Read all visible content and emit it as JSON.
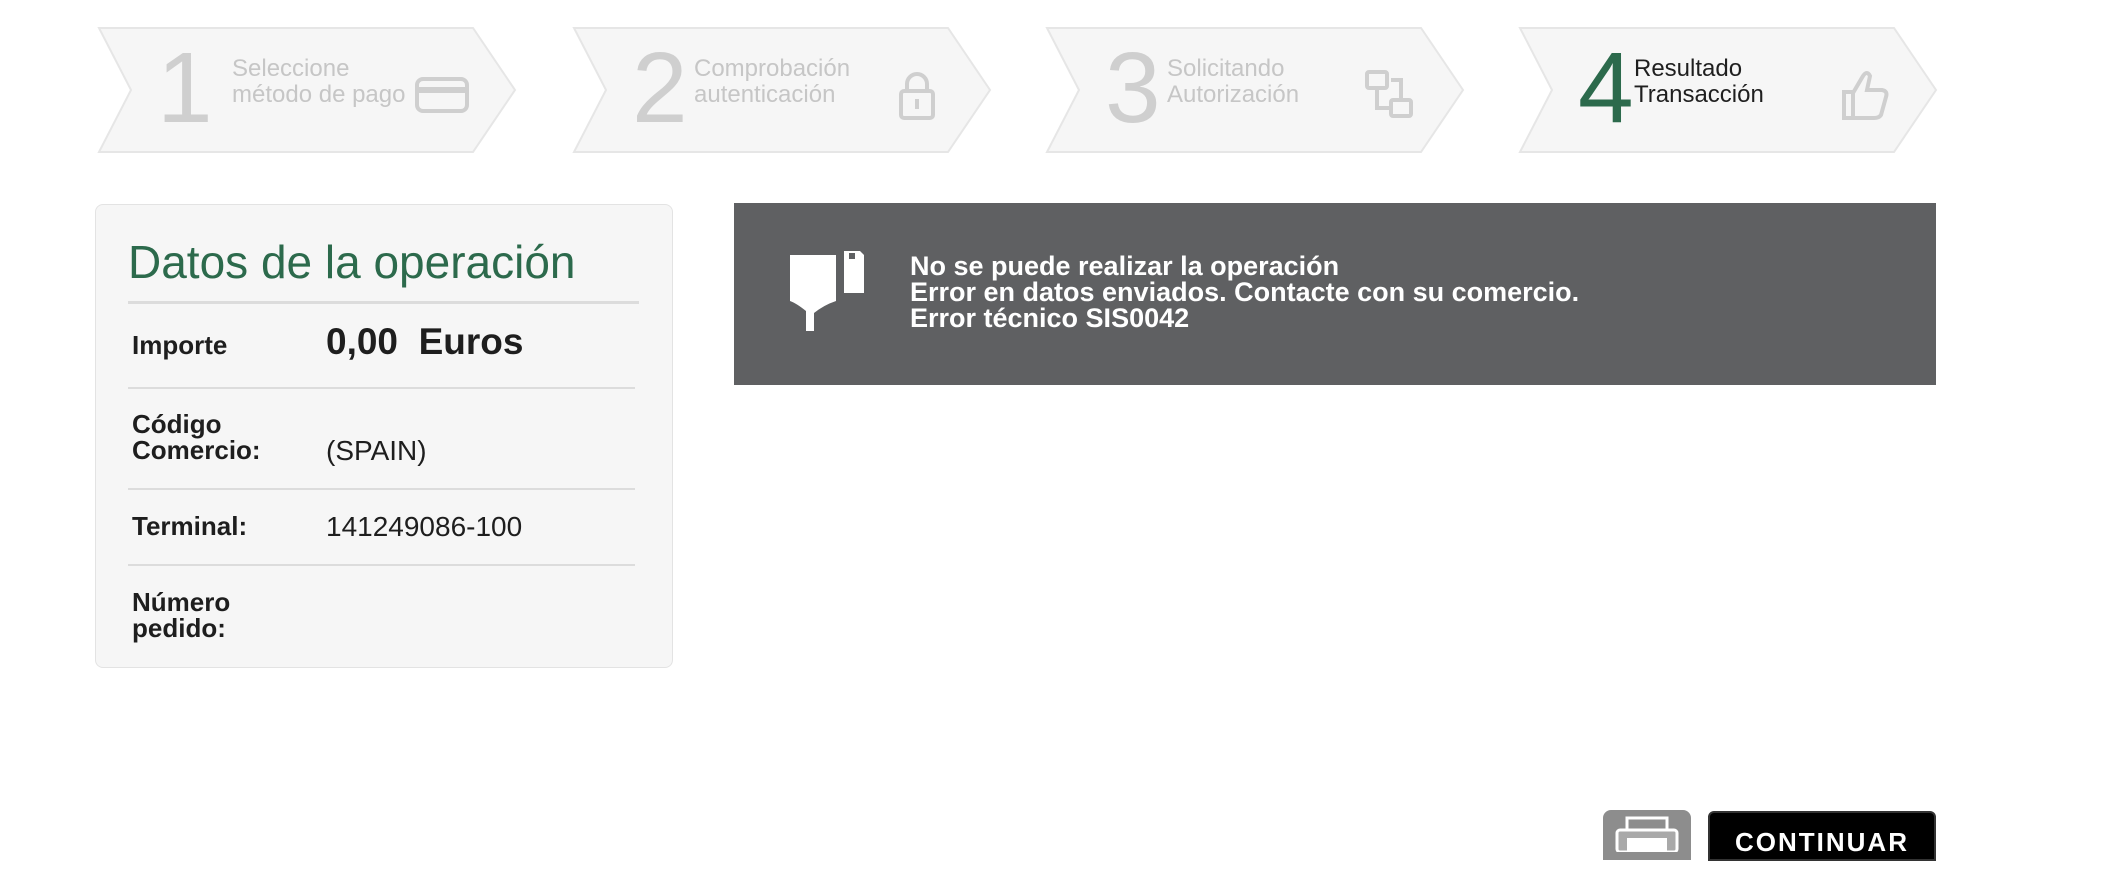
{
  "steps": [
    {
      "number": "1",
      "line1": "Seleccione",
      "line2": "método de pago",
      "icon": "credit-card-icon",
      "state": "inactive"
    },
    {
      "number": "2",
      "line1": "Comprobación",
      "line2": "autenticación",
      "icon": "lock-icon",
      "state": "inactive"
    },
    {
      "number": "3",
      "line1": "Solicitando",
      "line2": "Autorización",
      "icon": "transfer-icon",
      "state": "inactive"
    },
    {
      "number": "4",
      "line1": "Resultado",
      "line2": "Transacción",
      "icon": "thumbs-up-icon",
      "state": "active"
    }
  ],
  "operation": {
    "title": "Datos de la operación",
    "importe_label": "Importe",
    "importe_value": "0,00",
    "importe_currency": "Euros",
    "codigo_label_1": "Código",
    "codigo_label_2": "Comercio:",
    "codigo_value": "(SPAIN)",
    "terminal_label": "Terminal:",
    "terminal_value": "141249086-100",
    "pedido_label_1": "Número",
    "pedido_label_2": "pedido:",
    "pedido_value": ""
  },
  "error": {
    "icon": "thumbs-down-icon",
    "line1": "No se puede realizar la operación",
    "line2": "Error en datos enviados. Contacte con su comercio.",
    "line3": "Error técnico SIS0042"
  },
  "actions": {
    "print_icon": "printer-icon",
    "continue_label": "CONTINUAR"
  },
  "colors": {
    "accent_green": "#2c6a4c",
    "banner_gray": "#5f6062",
    "inactive_step": "#c6c6c6"
  }
}
